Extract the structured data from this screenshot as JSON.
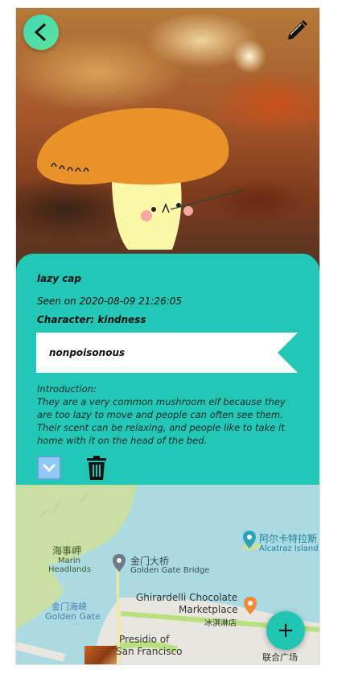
{
  "detail": {
    "name": "lazy cap",
    "seen": "Seen on 2020-08-09 21:26:05",
    "character": "Character: kindness",
    "toxicity": "nonpoisonous",
    "intro_label": "Introduction:",
    "intro_text": "They are a very common mushroom elf because they are too lazy to move and people can often see them. Their scent can be relaxing, and people like to take it home with it on the head of the bed."
  },
  "icons": {
    "back": "chevron-left-icon",
    "edit": "pencil-icon",
    "expand": "chevron-down-icon",
    "delete": "trash-icon",
    "add": "plus-icon"
  },
  "fab": {
    "label": "+"
  },
  "map": {
    "labels": {
      "marin_cn": "海事岬",
      "marin_en1": "Marin",
      "marin_en2": "Headlands",
      "ggb_cn": "金门大桥",
      "ggb_en": "Golden Gate Bridge",
      "gg_cn": "金门海峡",
      "gg_en": "Golden Gate",
      "alcatraz_cn": "阿尔卡特拉斯",
      "alcatraz_en": "Alcatraz Island",
      "ghirardelli1": "Ghirardelli Chocolate",
      "ghirardelli2": "Marketplace",
      "ghirardelli_cn": "冰淇淋店",
      "presidio1": "Presidio of",
      "presidio2": "San Francisco",
      "union_cn": "联合广场"
    }
  },
  "colors": {
    "accent": "#22c7b5",
    "back_button": "#4fdea6",
    "water": "#aadbe2",
    "land": "#c9dfa3"
  }
}
